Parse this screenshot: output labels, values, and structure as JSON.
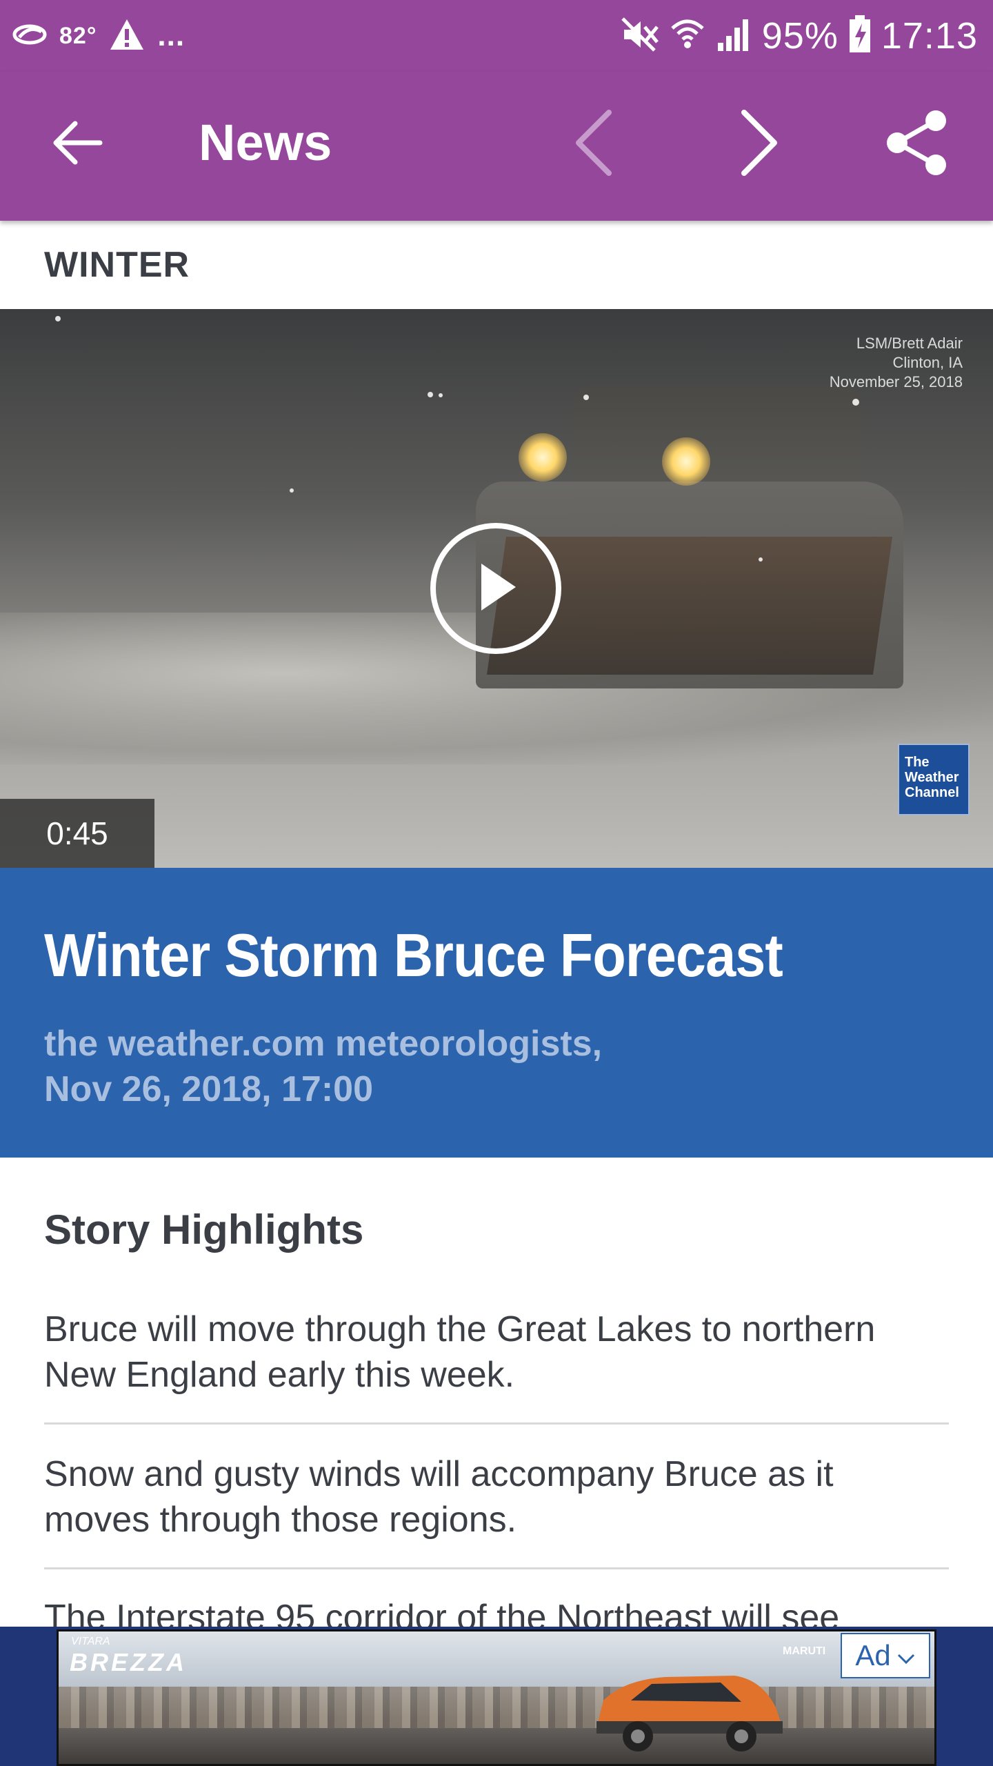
{
  "status_bar": {
    "temperature": "82°",
    "more": "...",
    "battery": "95%",
    "time": "17:13"
  },
  "app_bar": {
    "title": "News",
    "icons": [
      "back-arrow-icon",
      "chevron-left-icon",
      "chevron-right-icon",
      "share-icon"
    ]
  },
  "article": {
    "category": "WINTER",
    "video": {
      "duration": "0:45",
      "watermark_line1": "LSM/Brett Adair",
      "watermark_line2": "Clinton, IA",
      "watermark_line3": "November 25, 2018",
      "logo_line1": "The",
      "logo_line2": "Weather",
      "logo_line3": "Channel"
    },
    "headline": "Winter Storm Bruce Forecast",
    "byline_author": "the weather.com meteorologists,",
    "byline_date": "Nov 26, 2018, 17:00",
    "highlights_title": "Story Highlights",
    "highlights": [
      "Bruce will move through the Great Lakes to northern New England early this week.",
      "Snow and gusty winds will accompany Bruce as it moves through those regions.",
      "The Interstate 95 corridor of the Northeast will see"
    ]
  },
  "ad": {
    "brand": "BREZZA",
    "brand_small": "VITARA",
    "maker": "MARUTI",
    "badge": "Ad"
  },
  "colors": {
    "app_bar": "#95479b",
    "headline_bg": "#2c63ad",
    "byline": "#a9bfe0"
  }
}
